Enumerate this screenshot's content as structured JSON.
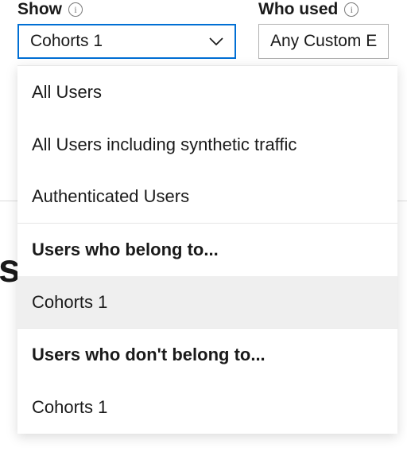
{
  "show_field": {
    "label": "Show",
    "selected": "Cohorts 1"
  },
  "who_used_field": {
    "label": "Who used",
    "selected": "Any Custom E"
  },
  "dropdown": {
    "opt_all_users": "All Users",
    "opt_synthetic": "All Users including synthetic traffic",
    "opt_authenticated": "Authenticated Users",
    "hdr_belong": "Users who belong to...",
    "opt_cohorts_belong": "Cohorts 1",
    "hdr_not_belong": "Users who don't belong to...",
    "opt_cohorts_not_belong": "Cohorts 1"
  },
  "behind": {
    "big_s": "s"
  }
}
